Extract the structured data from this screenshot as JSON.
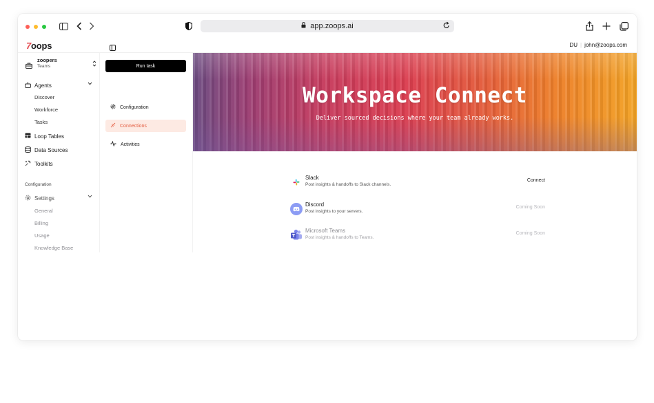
{
  "browser": {
    "url": "app.zoops.ai"
  },
  "app": {
    "logo_text": "oops",
    "logo_mark": "7",
    "user_initials": "DU",
    "user_email": "john@zoops.com"
  },
  "sidebar": {
    "team_name": "zoopers",
    "team_sub": "Teams",
    "agents_label": "Agents",
    "agents_children": [
      "Discover",
      "Workforce",
      "Tasks"
    ],
    "loop_tables": "Loop Tables",
    "data_sources": "Data Sources",
    "toolkits": "Toolkits",
    "configuration_label": "Configuration",
    "settings_label": "Settings",
    "settings_children": [
      "General",
      "Billing",
      "Usage",
      "Knowledge Base"
    ]
  },
  "panel": {
    "run_task": "Run task",
    "items": [
      "Configuration",
      "Connections",
      "Activities"
    ],
    "active_item": "Connections"
  },
  "banner": {
    "title": "Workspace Connect",
    "subtitle": "Deliver sourced decisions where your team already works."
  },
  "integrations": [
    {
      "name": "Slack",
      "description": "Post insights & handoffs to Slack channels.",
      "action": "Connect",
      "icon": "slack-icon"
    },
    {
      "name": "Discord",
      "description": "Post insights to your servers.",
      "action": "Coming Soon",
      "icon": "discord-icon"
    },
    {
      "name": "Microsoft Teams",
      "description": "Post insights & handoffs to Teams.",
      "action": "Coming Soon",
      "icon": "teams-icon"
    }
  ],
  "colors": {
    "accent": "#e35b3f",
    "active_bg": "#fdeae3",
    "discord": "#8c9cf4",
    "teams": "#7b83eb"
  }
}
